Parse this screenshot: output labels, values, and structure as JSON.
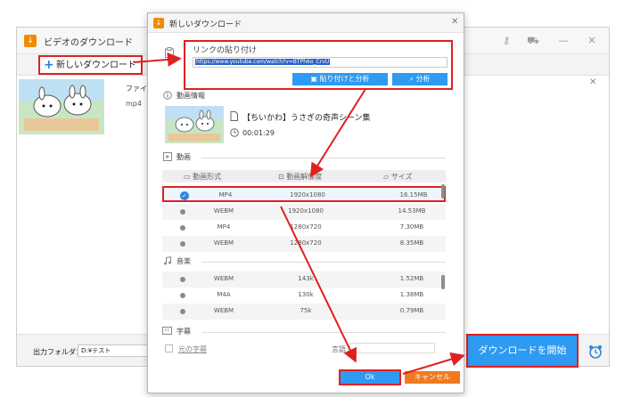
{
  "main_window": {
    "title": "ビデオのダウンロード",
    "new_download_label": "新しいダウンロード",
    "item": {
      "filename_label": "ファイル名",
      "format_label": "mp4"
    },
    "output_folder_label": "出力フォルダ：",
    "output_folder_value": "D:¥テスト",
    "start_button_label": "ダウンロードを開始"
  },
  "dialog": {
    "title": "新しいダウンロード",
    "paste_section_label": "リンクの貼り付け",
    "url_value": "https://www.youtube.com/watch?v=BTPh6o_CrvU",
    "paste_analyze_label": "貼り付けと分析",
    "analyze_label": "分析",
    "video_info_label": "動画情報",
    "video_title": "【ちいかわ】うさぎの奇声シーン集",
    "video_duration": "00:01:29",
    "video_section_label": "動画",
    "columns": {
      "format": "動画形式",
      "resolution": "動画解像度",
      "size": "サイズ"
    },
    "video_rows": [
      {
        "format": "MP4",
        "resolution": "1920x1080",
        "size": "16.15MB",
        "selected": true
      },
      {
        "format": "WEBM",
        "resolution": "1920x1080",
        "size": "14.53MB",
        "selected": false
      },
      {
        "format": "MP4",
        "resolution": "1280x720",
        "size": "7.30MB",
        "selected": false
      },
      {
        "format": "WEBM",
        "resolution": "1280x720",
        "size": "8.35MB",
        "selected": false
      }
    ],
    "audio_section_label": "音楽",
    "audio_rows": [
      {
        "format": "WEBM",
        "bitrate": "143k",
        "size": "1.52MB"
      },
      {
        "format": "M4A",
        "bitrate": "130k",
        "size": "1.38MB"
      },
      {
        "format": "WEBM",
        "bitrate": "75k",
        "size": "0.79MB"
      }
    ],
    "subtitle_section_label": "字幕",
    "original_subtitle_label": "元の字幕",
    "language_label": "言語",
    "ok_label": "Ok",
    "cancel_label": "キャンセル"
  },
  "colors": {
    "accent_blue": "#2e9af1",
    "highlight_red": "#e02020",
    "cancel_orange": "#f07a20",
    "check_blue": "#2e86de"
  }
}
